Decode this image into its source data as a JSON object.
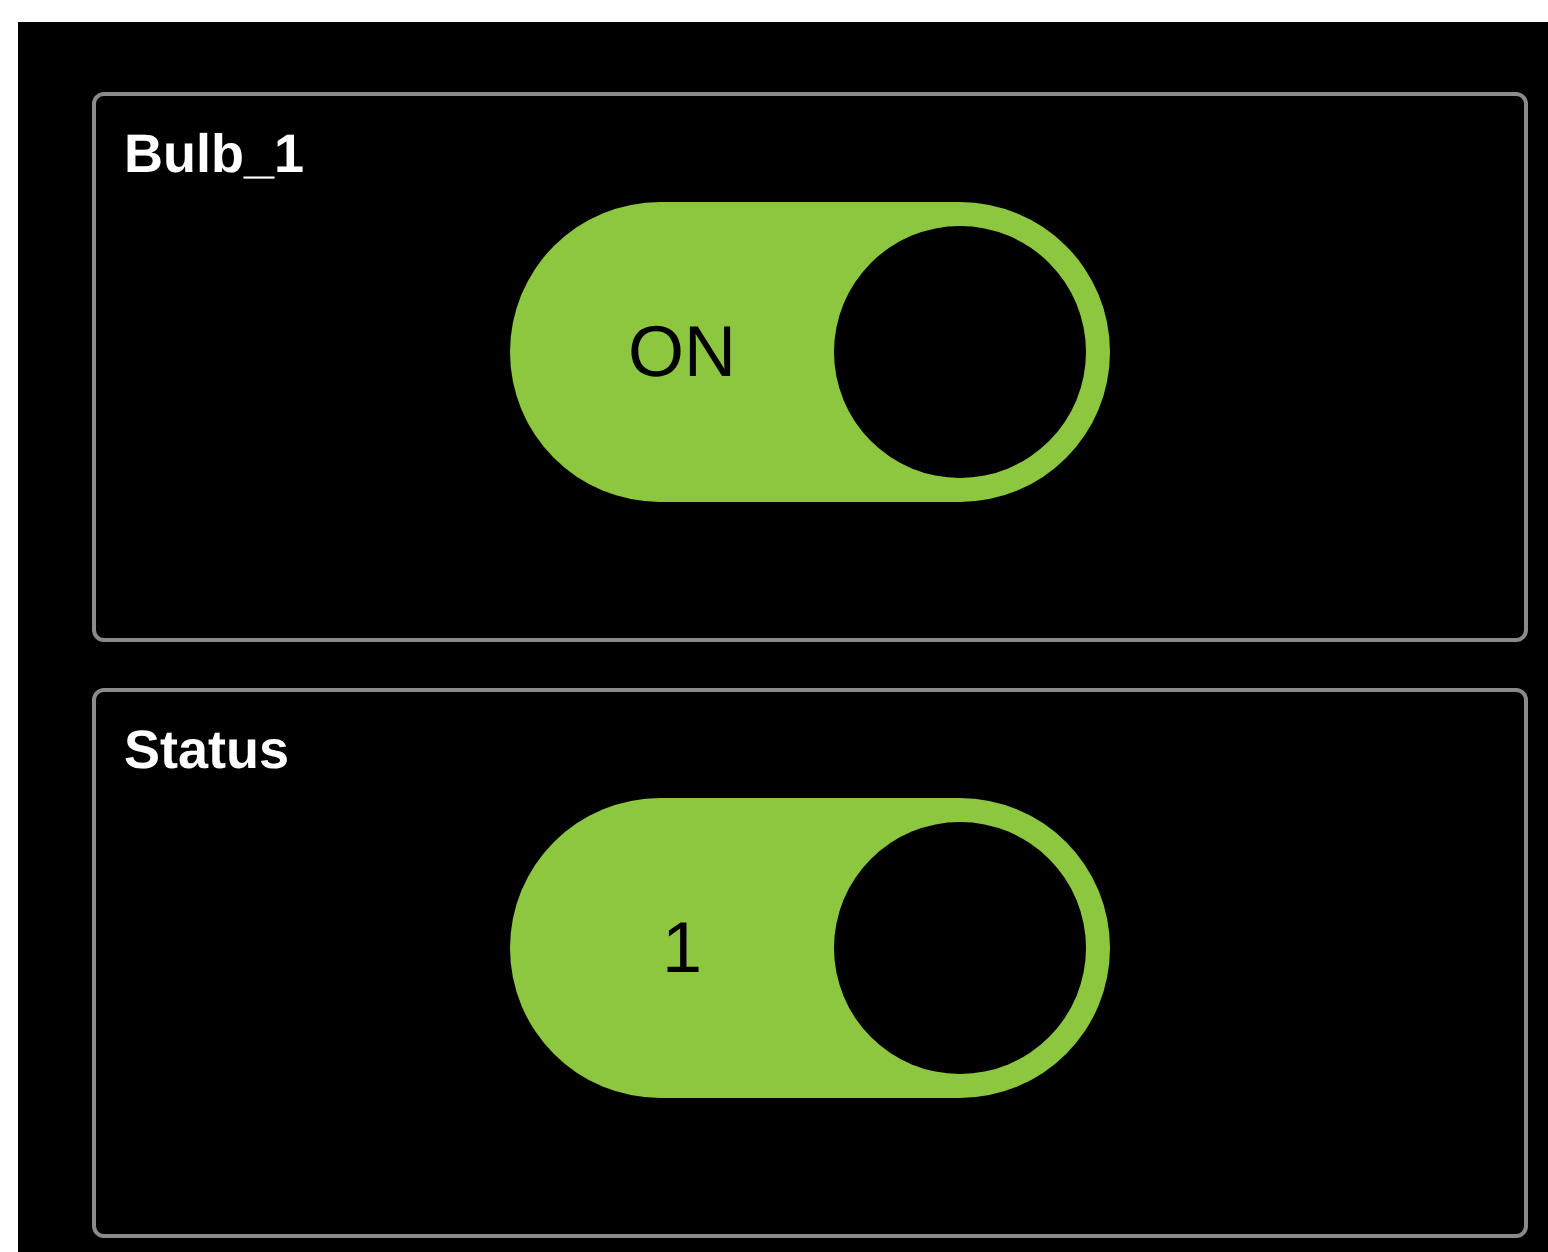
{
  "cards": [
    {
      "title": "Bulb_1",
      "toggle": {
        "on": true,
        "label": "ON"
      }
    },
    {
      "title": "Status",
      "toggle": {
        "on": true,
        "label": "1"
      }
    }
  ]
}
